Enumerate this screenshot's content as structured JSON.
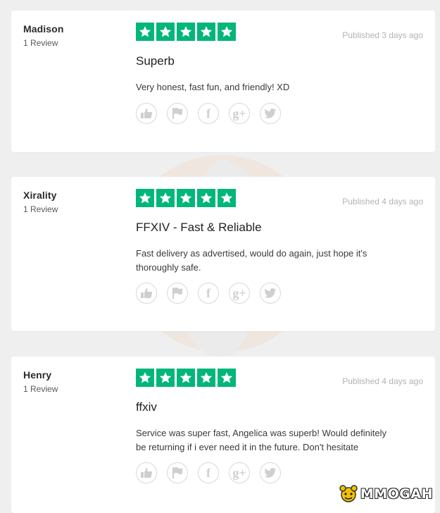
{
  "colors": {
    "star_green": "#00b67a",
    "muted_text": "#b3b3b3",
    "card_bg": "#ffffff",
    "page_bg": "#efefef"
  },
  "reviews": [
    {
      "author": "Madison",
      "review_count": "1 Review",
      "rating": 5,
      "published": "Published 3 days ago",
      "title": "Superb",
      "body_lines": [
        "Very honest, fast fun, and friendly! XD"
      ]
    },
    {
      "author": "Xirality",
      "review_count": "1 Review",
      "rating": 5,
      "published": "Published 4 days ago",
      "title": "FFXIV - Fast & Reliable",
      "body_lines": [
        "Fast delivery as advertised, would do again, just hope it's",
        "thoroughly safe."
      ]
    },
    {
      "author": "Henry",
      "review_count": "1 Review",
      "rating": 5,
      "published": "Published 4 days ago",
      "title": "ffxiv",
      "body_lines": [
        "Service was super fast, Angelica was superb! Would definitely",
        "be returning if i ever need it in the future. Don't hesitate"
      ]
    }
  ],
  "actions": [
    {
      "name": "like-icon",
      "glyph": ""
    },
    {
      "name": "flag-icon",
      "glyph": ""
    },
    {
      "name": "facebook-icon",
      "glyph": "f"
    },
    {
      "name": "google-plus-icon",
      "glyph": "g+"
    },
    {
      "name": "twitter-icon",
      "glyph": ""
    }
  ],
  "watermark_logo": {
    "text": "MMOGAH"
  }
}
